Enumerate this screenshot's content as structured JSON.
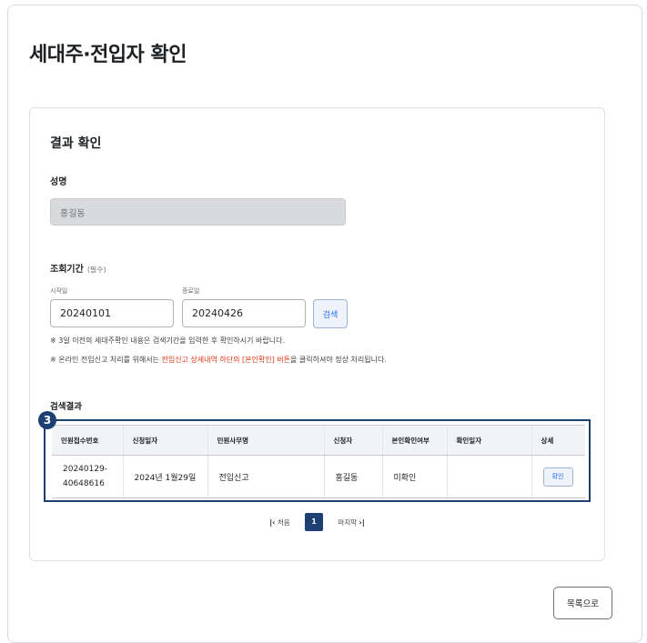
{
  "page": {
    "title": "세대주·전입자 확인"
  },
  "result_section": {
    "title": "결과 확인",
    "name_label": "성명",
    "name_value": "홍길동"
  },
  "period": {
    "label": "조회기간",
    "required": "(필수)",
    "start_label": "시작일",
    "start_value": "20240101",
    "end_label": "종료일",
    "end_value": "20240426",
    "search_button": "검색"
  },
  "notices": {
    "line1": "※ 3일 이전의 세대주확인 내용은 검색기간을 입력한 후 확인하시기 바랍니다.",
    "line2_prefix": "※ 온라인 전입신고 처리를 위해서는 ",
    "line2_highlight": "전입신고 상세내역 하단의 [본인확인] 버튼",
    "line2_suffix": "을 클릭하셔야 정상 처리됩니다."
  },
  "results": {
    "title": "검색결과",
    "annotation_number": "3",
    "columns": [
      "민원접수번호",
      "신청일자",
      "민원사무명",
      "신청자",
      "본인확인여부",
      "확인일자",
      "상세"
    ],
    "rows": [
      {
        "receipt_no_line1": "20240129-",
        "receipt_no_line2": "40648616",
        "date": "2024년 1월29일",
        "service": "전입신고",
        "applicant": "홍길동",
        "verified": "미확인",
        "confirm_date": "",
        "detail_button": "확인"
      }
    ]
  },
  "pagination": {
    "first_icon": "first-page-icon",
    "first_label": "처음",
    "current_page": "1",
    "last_label": "마지막",
    "last_icon": "last-page-icon"
  },
  "footer": {
    "list_button": "목록으로"
  },
  "colors": {
    "accent": "#1d3f72",
    "link_blue": "#256ef4",
    "warning_red": "#de3412",
    "disabled_field": "#d9dadb"
  }
}
